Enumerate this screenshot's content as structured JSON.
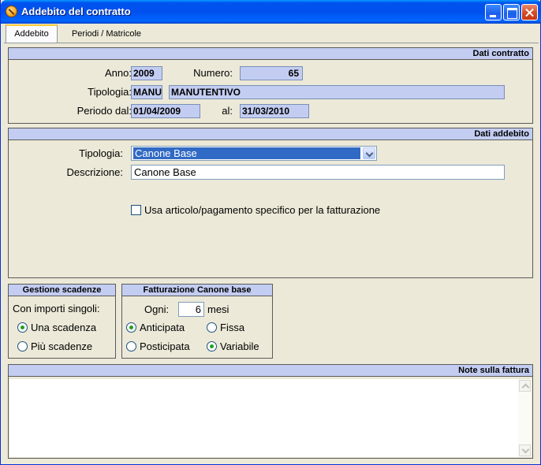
{
  "window": {
    "title": "Addebito del contratto"
  },
  "tabs": [
    {
      "label": "Addebito",
      "active": true
    },
    {
      "label": "Periodi / Matricole",
      "active": false
    }
  ],
  "dati_contratto": {
    "header": "Dati contratto",
    "anno_label": "Anno:",
    "anno": "2009",
    "numero_label": "Numero:",
    "numero": "65",
    "tipologia_label": "Tipologia:",
    "tipologia_code": "MANU",
    "tipologia_desc": "MANUTENTIVO",
    "periodo_label": "Periodo dal:",
    "periodo_dal": "01/04/2009",
    "al_label": "al:",
    "periodo_al": "31/03/2010"
  },
  "dati_addebito": {
    "header": "Dati addebito",
    "tipologia_label": "Tipologia:",
    "tipologia_value": "Canone  Base",
    "descrizione_label": "Descrizione:",
    "descrizione_value": "Canone  Base",
    "usa_articolo_label": "Usa articolo/pagamento specifico per la fatturazione",
    "usa_articolo_checked": false
  },
  "gestione_scadenze": {
    "header": "Gestione scadenze",
    "con_importi_label": "Con importi singoli:",
    "options": [
      {
        "label": "Una scadenza",
        "selected": true
      },
      {
        "label": "Più scadenze",
        "selected": false
      }
    ]
  },
  "fatturazione": {
    "header": "Fatturazione Canone base",
    "ogni_label": "Ogni:",
    "ogni_value": "6",
    "mesi_label": "mesi",
    "anticipata_label": "Anticipata",
    "anticipata_selected": true,
    "posticipata_label": "Posticipata",
    "posticipata_selected": false,
    "fissa_label": "Fissa",
    "fissa_selected": false,
    "variabile_label": "Variabile",
    "variabile_selected": true
  },
  "note": {
    "header": "Note sulla fattura",
    "value": ""
  },
  "colors": {
    "title_bar": "#0053ee",
    "panel_header": "#c3cdf2",
    "readonly_field": "#c3cdf2",
    "selection": "#316ac5",
    "window_bg": "#ece9d8"
  }
}
